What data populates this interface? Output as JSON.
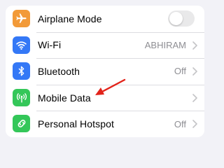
{
  "colors": {
    "airplane": "#f29a38",
    "wifi": "#3478f6",
    "bluetooth": "#3478f6",
    "mobile_data": "#34c759",
    "hotspot": "#34c759",
    "annotation_arrow": "#e2231a"
  },
  "settings": {
    "rows": [
      {
        "label": "Airplane Mode",
        "icon": "airplane-icon",
        "control": "toggle",
        "toggle_on": false
      },
      {
        "label": "Wi-Fi",
        "icon": "wifi-icon",
        "value": "ABHIRAM",
        "control": "chevron"
      },
      {
        "label": "Bluetooth",
        "icon": "bluetooth-icon",
        "value": "Off",
        "control": "chevron"
      },
      {
        "label": "Mobile Data",
        "icon": "antenna-icon",
        "control": "chevron"
      },
      {
        "label": "Personal Hotspot",
        "icon": "hotspot-icon",
        "value": "Off",
        "control": "chevron"
      }
    ]
  }
}
